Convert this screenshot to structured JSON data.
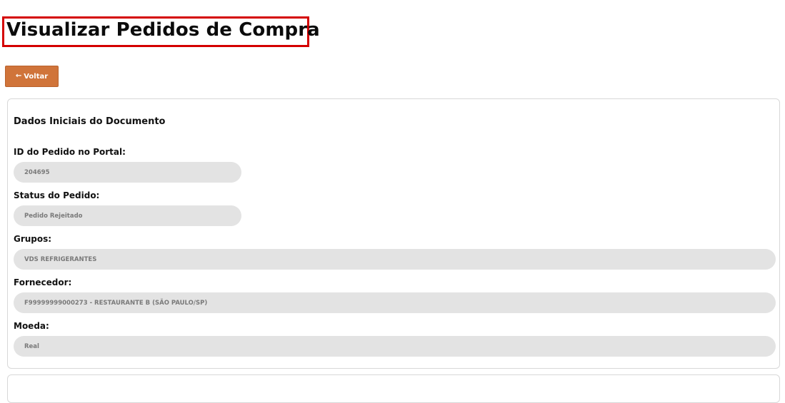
{
  "page": {
    "title": "Visualizar Pedidos de Compra",
    "back_label": "Voltar",
    "colors": {
      "accent": "#d0743a",
      "highlight_border": "#d40000",
      "field_bg": "#e3e3e3"
    }
  },
  "card": {
    "section_title": "Dados Iniciais do Documento",
    "fields": [
      {
        "label": "ID do Pedido no Portal:",
        "value": "204695"
      },
      {
        "label": "Status do Pedido:",
        "value": "Pedido Rejeitado"
      },
      {
        "label": "Grupos:",
        "value": "VDS REFRIGERANTES"
      },
      {
        "label": "Fornecedor:",
        "value": "F99999999000273 - RESTAURANTE B (SÃO PAULO/SP)"
      },
      {
        "label": "Moeda:",
        "value": "Real"
      }
    ]
  },
  "icons": {
    "back": "arrow-left-icon"
  }
}
